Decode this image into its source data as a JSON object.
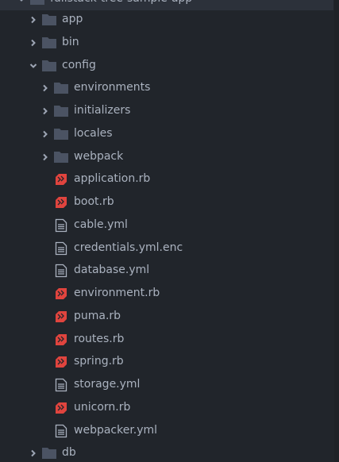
{
  "tree": {
    "root_label": "fullstack-tree-sample-app",
    "top": {
      "app": "app",
      "bin": "bin",
      "config": "config",
      "db": "db"
    },
    "config_children": {
      "environments": "environments",
      "initializers": "initializers",
      "locales": "locales",
      "webpack": "webpack",
      "application_rb": "application.rb",
      "boot_rb": "boot.rb",
      "cable_yml": "cable.yml",
      "credentials_yml_enc": "credentials.yml.enc",
      "database_yml": "database.yml",
      "environment_rb": "environment.rb",
      "puma_rb": "puma.rb",
      "routes_rb": "routes.rb",
      "spring_rb": "spring.rb",
      "storage_yml": "storage.yml",
      "unicorn_rb": "unicorn.rb",
      "webpacker_yml": "webpacker.yml"
    }
  },
  "colors": {
    "background": "#21252b",
    "text": "#aab2bf",
    "folder": "#4b5363",
    "ruby": "#e0443e",
    "file": "#aab2bf"
  },
  "icons": {
    "folder": "folder-icon",
    "ruby": "ruby-icon",
    "file": "file-text-icon",
    "collapsed": "chevron-right-icon",
    "expanded": "chevron-down-icon"
  }
}
